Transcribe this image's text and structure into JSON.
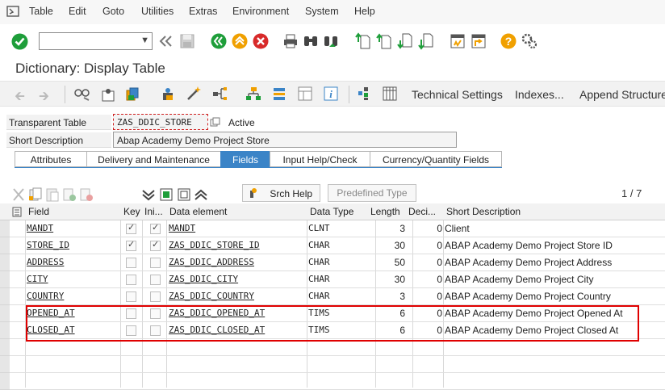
{
  "menu": [
    "Table",
    "Edit",
    "Goto",
    "Utilities",
    "Extras",
    "Environment",
    "System",
    "Help"
  ],
  "command_field": {
    "value": ""
  },
  "title": "Dictionary: Display Table",
  "toolbar2": {
    "technical_settings": "Technical Settings",
    "indexes": "Indexes...",
    "append_structure": "Append Structure"
  },
  "header": {
    "transparent_table_label": "Transparent Table",
    "table_name": "ZAS_DDIC_STORE",
    "status": "Active",
    "short_description_label": "Short Description",
    "short_description": "Abap Academy Demo Project Store"
  },
  "tabs": [
    "Attributes",
    "Delivery and Maintenance",
    "Fields",
    "Input Help/Check",
    "Currency/Quantity Fields"
  ],
  "active_tab": "Fields",
  "grid_toolbar": {
    "srch_help": "Srch Help",
    "predefined_type": "Predefined Type",
    "pager": "1 / 7"
  },
  "columns": [
    "Field",
    "Key",
    "Ini...",
    "Data element",
    "Data Type",
    "Length",
    "Deci...",
    "Short Description"
  ],
  "rows": [
    {
      "field": "MANDT",
      "key": true,
      "init": true,
      "data_element": "MANDT",
      "data_type": "CLNT",
      "length": "3",
      "decimals": "0",
      "short_description": "Client"
    },
    {
      "field": "STORE_ID",
      "key": true,
      "init": true,
      "data_element": "ZAS_DDIC_STORE_ID",
      "data_type": "CHAR",
      "length": "30",
      "decimals": "0",
      "short_description": "ABAP Academy Demo Project Store ID"
    },
    {
      "field": "ADDRESS",
      "key": false,
      "init": false,
      "data_element": "ZAS_DDIC_ADDRESS",
      "data_type": "CHAR",
      "length": "50",
      "decimals": "0",
      "short_description": "ABAP Academy Demo Project Address"
    },
    {
      "field": "CITY",
      "key": false,
      "init": false,
      "data_element": "ZAS_DDIC_CITY",
      "data_type": "CHAR",
      "length": "30",
      "decimals": "0",
      "short_description": "ABAP Academy Demo Project City"
    },
    {
      "field": "COUNTRY",
      "key": false,
      "init": false,
      "data_element": "ZAS_DDIC_COUNTRY",
      "data_type": "CHAR",
      "length": "3",
      "decimals": "0",
      "short_description": "ABAP Academy Demo Project Country"
    },
    {
      "field": "OPENED_AT",
      "key": false,
      "init": false,
      "data_element": "ZAS_DDIC_OPENED_AT",
      "data_type": "TIMS",
      "length": "6",
      "decimals": "0",
      "short_description": "ABAP Academy Demo Project Opened At"
    },
    {
      "field": "CLOSED_AT",
      "key": false,
      "init": false,
      "data_element": "ZAS_DDIC_CLOSED_AT",
      "data_type": "TIMS",
      "length": "6",
      "decimals": "0",
      "short_description": "ABAP Academy Demo Project Closed At"
    }
  ],
  "colors": {
    "accent": "#3b84c7",
    "highlight": "#e00000",
    "ok_green": "#1e9e3a"
  },
  "icons": [
    "sap-app-icon",
    "enter-check-icon",
    "back-icon",
    "save-icon",
    "green-back-icon",
    "exit-icon",
    "cancel-icon",
    "print-icon",
    "find-icon",
    "find-next-icon",
    "first-page-icon",
    "prev-page-icon",
    "next-page-icon",
    "last-page-icon",
    "create-session-icon",
    "shortcut-icon",
    "help-icon",
    "customize-layout-icon"
  ]
}
